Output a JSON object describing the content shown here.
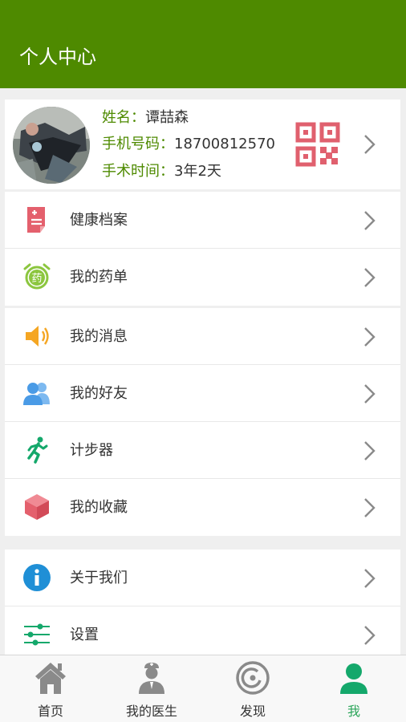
{
  "header": {
    "title": "个人中心"
  },
  "profile": {
    "name_label": "姓名：",
    "name": "谭喆森",
    "phone_label": "手机号码：",
    "phone": "18700812570",
    "surgery_label": "手术时间：",
    "surgery": "3年2天"
  },
  "menu": {
    "health_records": "健康档案",
    "my_prescriptions": "我的药单",
    "my_messages": "我的消息",
    "my_friends": "我的好友",
    "pedometer": "计步器",
    "my_favorites": "我的收藏",
    "about_us": "关于我们",
    "settings": "设置"
  },
  "pill_icon_text": "药",
  "tabbar": {
    "home": "首页",
    "my_doctor": "我的医生",
    "discover": "发现",
    "me": "我",
    "active": "me"
  },
  "colors": {
    "header_bg": "#4e8a00",
    "accent_green": "#4e8a00",
    "tab_active": "#2ca55a",
    "qr_red": "#e0606e"
  }
}
